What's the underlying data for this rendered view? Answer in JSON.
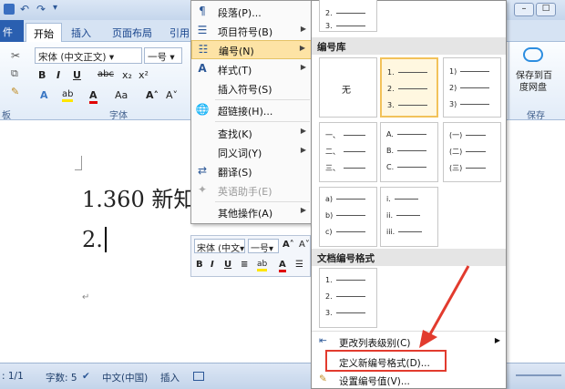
{
  "quick_access": {
    "save_icon": "save-icon",
    "undo_icon": "undo-icon",
    "redo_icon": "redo-icon"
  },
  "window_controls": {
    "minimize": "minimize-icon",
    "maximize": "maximize-icon"
  },
  "tabs": {
    "file": "件",
    "items": [
      "开始",
      "插入",
      "页面布局",
      "引用"
    ]
  },
  "ribbon": {
    "font_name": "宋体 (中文正文)",
    "font_size": "一号",
    "group_font": "字体",
    "group_clipboard": "板",
    "group_save": "保存",
    "save_baidu_label_1": "保存到百",
    "save_baidu_label_2": "度网盘"
  },
  "document": {
    "line1": "1.360 新知",
    "line2": "2."
  },
  "mini_toolbar": {
    "font": "宋体 (中文",
    "size": "一号"
  },
  "context_menu": {
    "items": [
      {
        "label": "段落(P)...",
        "icon": "paragraph-icon"
      },
      {
        "label": "项目符号(B)",
        "icon": "bullets-icon",
        "arrow": "▶"
      },
      {
        "label": "编号(N)",
        "icon": "numbering-icon",
        "arrow": "▶"
      },
      {
        "label": "样式(T)",
        "icon": "styles-icon",
        "arrow": "▶"
      },
      {
        "label": "插入符号(S)",
        "icon": ""
      },
      {
        "label": "超链接(H)...",
        "icon": "hyperlink-icon"
      },
      {
        "label": "查找(K)",
        "icon": "",
        "arrow": "▶"
      },
      {
        "label": "同义词(Y)",
        "icon": "",
        "arrow": "▶"
      },
      {
        "label": "翻译(S)",
        "icon": "translate-icon"
      },
      {
        "label": "英语助手(E)",
        "icon": "english-assistant-icon"
      },
      {
        "label": "其他操作(A)",
        "icon": "",
        "arrow": "▶"
      }
    ]
  },
  "gallery": {
    "top_partial": [
      "2.",
      "3."
    ],
    "library_title": "编号库",
    "none_label": "无",
    "formats": [
      [
        "1.",
        "2.",
        "3."
      ],
      [
        "1)",
        "2)",
        "3)"
      ],
      [
        "一、",
        "二、",
        "三、"
      ],
      [
        "A.",
        "B.",
        "C."
      ],
      [
        "(一)",
        "(二)",
        "(三)"
      ],
      [
        "a)",
        "b)",
        "c)"
      ],
      [
        "i.",
        "ii.",
        "iii."
      ]
    ],
    "doc_formats_title": "文档编号格式",
    "doc_format": [
      "1.",
      "2.",
      "3."
    ],
    "footer": [
      "更改列表级别(C)",
      "定义新编号格式(D)...",
      "设置编号值(V)..."
    ]
  },
  "statusbar": {
    "page": ": 1/1",
    "words": "字数: 5",
    "language": "中文(中国)",
    "insert": "插入"
  }
}
